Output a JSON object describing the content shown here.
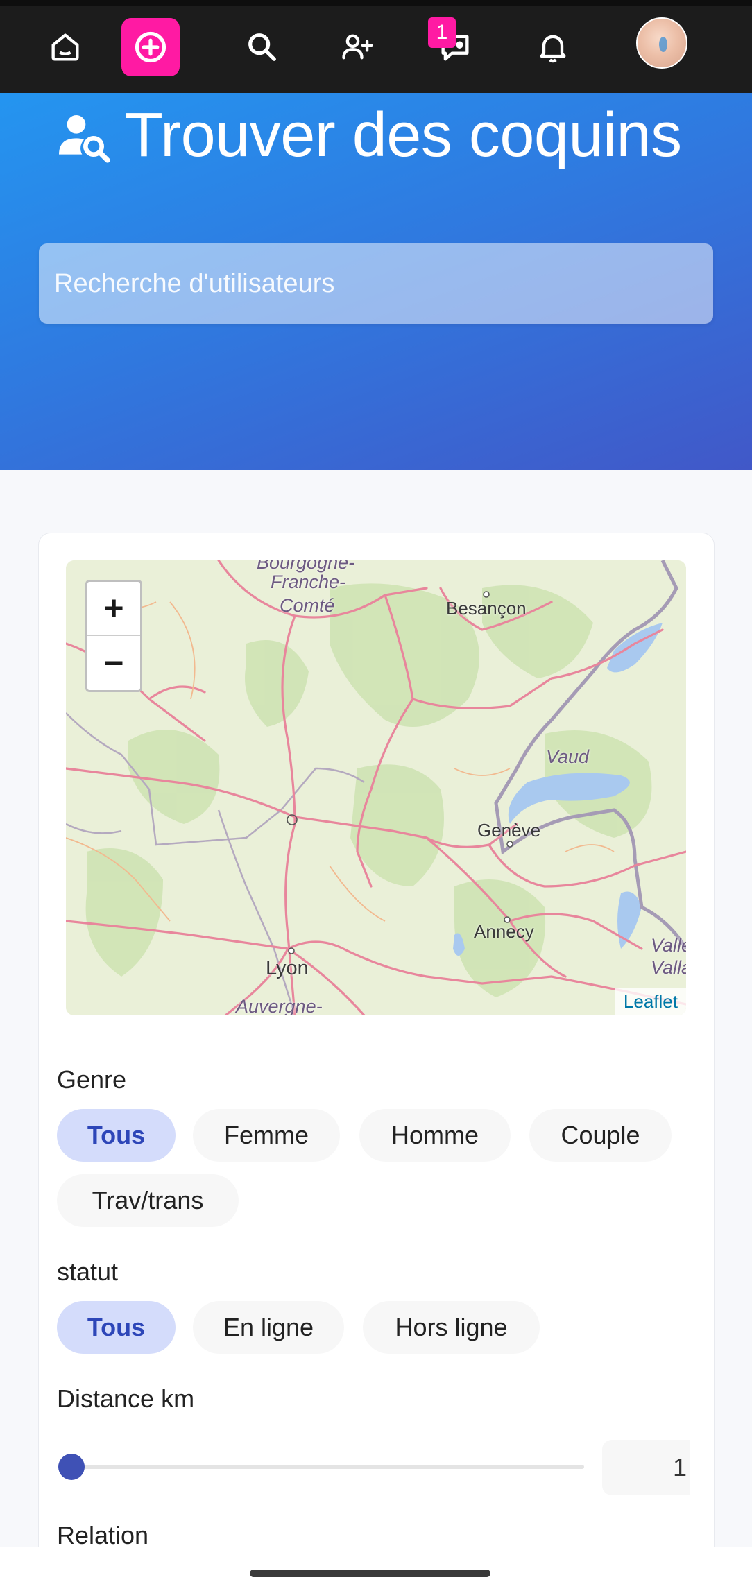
{
  "nav": {
    "home_icon": "home-icon",
    "add_icon": "plus-circle-icon",
    "search_icon": "search-icon",
    "user_add_icon": "user-plus-icon",
    "messages_icon": "message-icon",
    "messages_badge": "1",
    "notifications_icon": "bell-icon",
    "accent_color": "#ff1aa3"
  },
  "hero": {
    "title": "Trouver des coquins",
    "search_placeholder": "Recherche d'utilisateurs"
  },
  "map": {
    "zoom_in": "+",
    "zoom_out": "−",
    "attribution": "Leaflet",
    "labels": {
      "bourgogne": "Bourgogne-",
      "franche": "Franche-",
      "comte": "Comté",
      "besancon": "Besançon",
      "vaud": "Vaud",
      "geneve": "Genève",
      "annecy": "Annecy",
      "lyon": "Lyon",
      "auvergne": "Auvergne-",
      "valais1": "Valle",
      "valais2": "Valla"
    }
  },
  "filters": {
    "genre_label": "Genre",
    "genre_options": [
      "Tous",
      "Femme",
      "Homme",
      "Couple",
      "Trav/trans"
    ],
    "genre_selected": "Tous",
    "statut_label": "statut",
    "statut_options": [
      "Tous",
      "En ligne",
      "Hors ligne"
    ],
    "statut_selected": "Tous",
    "distance_label": "Distance km",
    "distance_value": "1",
    "relation_label": "Relation"
  }
}
